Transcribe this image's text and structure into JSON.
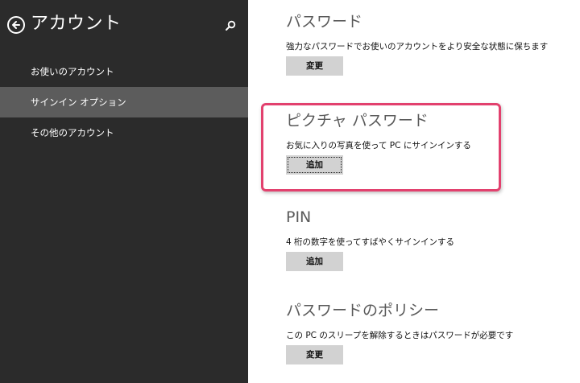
{
  "sidebar": {
    "title": "アカウント",
    "back_icon": "back-arrow-circle-icon",
    "search_icon": "search-icon",
    "items": [
      {
        "label": "お使いのアカウント",
        "selected": false
      },
      {
        "label": "サインイン オプション",
        "selected": true
      },
      {
        "label": "その他のアカウント",
        "selected": false
      }
    ]
  },
  "sections": {
    "password": {
      "title": "パスワード",
      "description": "強力なパスワードでお使いのアカウントをより安全な状態に保ちます",
      "button": "変更"
    },
    "picture_password": {
      "title": "ピクチャ パスワード",
      "description": "お気に入りの写真を使って PC にサインインする",
      "button": "追加"
    },
    "pin": {
      "title": "PIN",
      "description": "4 桁の数字を使ってすばやくサインインする",
      "button": "追加"
    },
    "password_policy": {
      "title": "パスワードのポリシー",
      "description": "この PC のスリープを解除するときはパスワードが必要です",
      "button": "変更"
    }
  },
  "colors": {
    "sidebar_bg": "#2b2b2b",
    "selected_item_bg": "#5c5c5c",
    "button_bg": "#d2d2d2",
    "highlight": "#e2416e"
  }
}
